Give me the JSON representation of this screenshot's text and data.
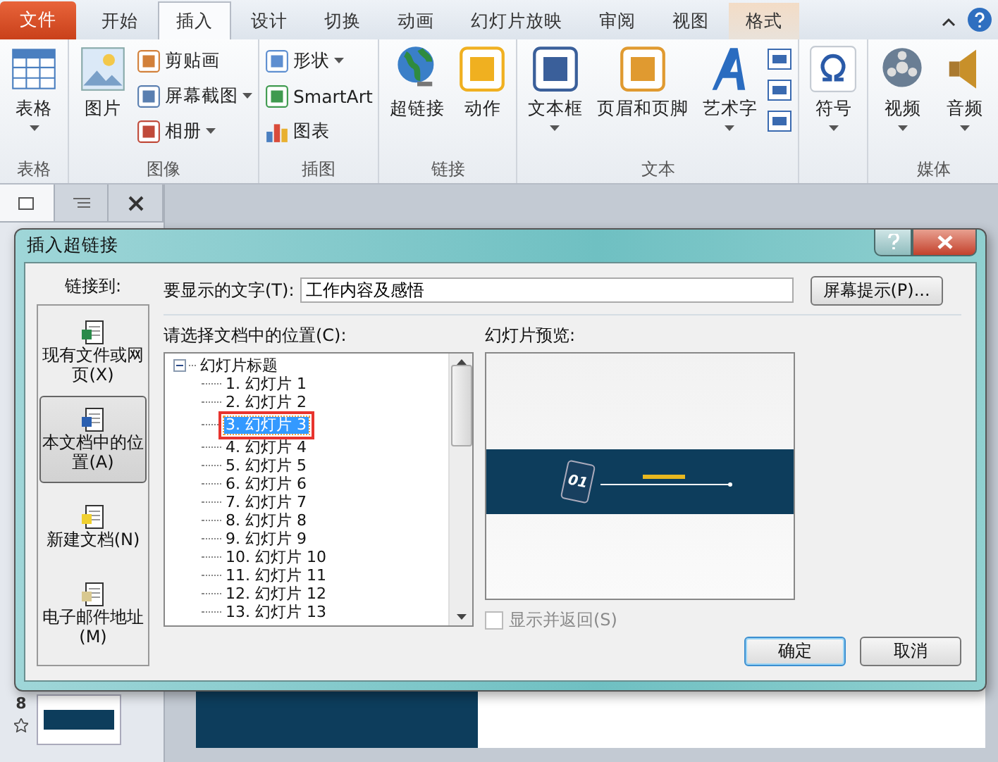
{
  "ribbon_tabs": [
    {
      "label": "文件",
      "kind": "file",
      "selected": false
    },
    {
      "label": "开始",
      "kind": "normal",
      "selected": false
    },
    {
      "label": "插入",
      "kind": "normal",
      "selected": true
    },
    {
      "label": "设计",
      "kind": "normal",
      "selected": false
    },
    {
      "label": "切换",
      "kind": "normal",
      "selected": false
    },
    {
      "label": "动画",
      "kind": "normal",
      "selected": false
    },
    {
      "label": "幻灯片放映",
      "kind": "normal",
      "selected": false
    },
    {
      "label": "审阅",
      "kind": "normal",
      "selected": false
    },
    {
      "label": "视图",
      "kind": "normal",
      "selected": false
    },
    {
      "label": "格式",
      "kind": "contextual",
      "selected": false
    }
  ],
  "ribbon_groups": [
    {
      "label": "表格",
      "items": [
        {
          "label": "表格",
          "kind": "large",
          "dropdown": true
        }
      ]
    },
    {
      "label": "图像",
      "items": [
        {
          "label": "图片",
          "kind": "large",
          "dropdown": false
        },
        {
          "label": "剪贴画",
          "kind": "small",
          "dropdown": false
        },
        {
          "label": "屏幕截图",
          "kind": "small",
          "dropdown": true
        },
        {
          "label": "相册",
          "kind": "small",
          "dropdown": true
        }
      ]
    },
    {
      "label": "插图",
      "items": [
        {
          "label": "形状",
          "kind": "small",
          "dropdown": true
        },
        {
          "label": "SmartArt",
          "kind": "small",
          "dropdown": false
        },
        {
          "label": "图表",
          "kind": "small",
          "dropdown": false
        }
      ]
    },
    {
      "label": "链接",
      "items": [
        {
          "label": "超链接",
          "kind": "large",
          "dropdown": false
        },
        {
          "label": "动作",
          "kind": "large",
          "dropdown": false
        }
      ]
    },
    {
      "label": "文本",
      "items": [
        {
          "label": "文本框",
          "kind": "large",
          "dropdown": true
        },
        {
          "label": "页眉和页脚",
          "kind": "large",
          "dropdown": false
        },
        {
          "label": "艺术字",
          "kind": "large",
          "dropdown": true
        },
        {
          "kind": "icons"
        }
      ]
    },
    {
      "items": [
        {
          "label": "符号",
          "kind": "large",
          "dropdown": true
        }
      ]
    },
    {
      "label": "媒体",
      "items": [
        {
          "label": "视频",
          "kind": "large",
          "dropdown": true
        },
        {
          "label": "音频",
          "kind": "large",
          "dropdown": true
        }
      ]
    }
  ],
  "slide_pane": {
    "slide_number": "8"
  },
  "dialog": {
    "title": "插入超链接",
    "link_to_label": "链接到:",
    "link_targets": [
      {
        "label": "现有文件或网页(X)",
        "selected": false
      },
      {
        "label": "本文档中的位置(A)",
        "selected": true
      },
      {
        "label": "新建文档(N)",
        "selected": false
      },
      {
        "label": "电子邮件地址(M)",
        "selected": false
      }
    ],
    "display_text_label": "要显示的文字(T):",
    "display_text_value": "工作内容及感悟",
    "screentip_button": "屏幕提示(P)...",
    "location_label": "请选择文档中的位置(C):",
    "tree": {
      "label": "幻灯片标题",
      "expanded": true,
      "children": [
        {
          "label": "1.  幻灯片 1",
          "selected": false
        },
        {
          "label": "2.  幻灯片 2",
          "selected": false
        },
        {
          "label": "3.  幻灯片 3",
          "selected": true
        },
        {
          "label": "4.  幻灯片 4",
          "selected": false
        },
        {
          "label": "5.  幻灯片 5",
          "selected": false
        },
        {
          "label": "6.  幻灯片 6",
          "selected": false
        },
        {
          "label": "7.  幻灯片 7",
          "selected": false
        },
        {
          "label": "8.  幻灯片 8",
          "selected": false
        },
        {
          "label": "9.  幻灯片 9",
          "selected": false
        },
        {
          "label": "10.  幻灯片 10",
          "selected": false
        },
        {
          "label": "11.  幻灯片 11",
          "selected": false
        },
        {
          "label": "12.  幻灯片 12",
          "selected": false
        },
        {
          "label": "13.  幻灯片 13",
          "selected": false
        }
      ]
    },
    "preview_label": "幻灯片预览:",
    "preview_badge": "01",
    "show_and_return": {
      "label": "显示并返回(S)",
      "checked": false,
      "disabled": true
    },
    "buttons": [
      {
        "label": "确定",
        "default": true
      },
      {
        "label": "取消",
        "default": false
      }
    ]
  }
}
